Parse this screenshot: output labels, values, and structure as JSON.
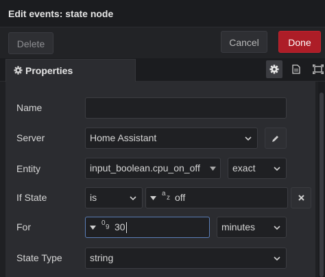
{
  "dialog": {
    "title": "Edit events: state node"
  },
  "actions": {
    "delete_label": "Delete",
    "cancel_label": "Cancel",
    "done_label": "Done"
  },
  "tabs": {
    "properties_label": "Properties"
  },
  "form": {
    "name": {
      "label": "Name",
      "value": ""
    },
    "server": {
      "label": "Server",
      "value": "Home Assistant"
    },
    "entity": {
      "label": "Entity",
      "value": "input_boolean.cpu_on_off",
      "match": "exact"
    },
    "if_state": {
      "label": "If State",
      "operator": "is",
      "type_glyph_top": "a",
      "type_glyph_bottom": "z",
      "value": "off"
    },
    "for": {
      "label": "For",
      "type_glyph_top": "0",
      "type_glyph_bottom": "9",
      "value": "30",
      "unit": "minutes"
    },
    "state_type": {
      "label": "State Type",
      "value": "string"
    }
  },
  "colors": {
    "done": "#ad1d27",
    "background": "#1f2023",
    "panel": "#2b2c30",
    "focus": "#5b7fb8"
  }
}
